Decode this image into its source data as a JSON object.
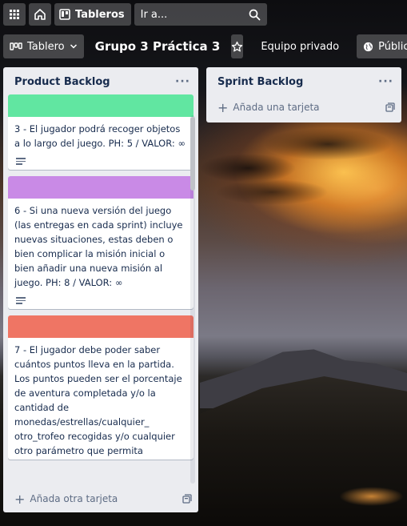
{
  "colors": {
    "label_green": "#61e6a1",
    "label_purple": "#c98ae6",
    "label_red": "#ef7564",
    "list_bg": "#ebecf0"
  },
  "topbar": {
    "apps_icon": "grid-icon",
    "home_icon": "home-icon",
    "boards_label": "Tableros",
    "search_placeholder": "Ir a...",
    "search_icon": "search-icon"
  },
  "boardbar": {
    "view_label": "Tablero",
    "title": "Grupo 3 Práctica 3",
    "team_label": "Equipo privado",
    "visibility_label": "Público"
  },
  "lists": [
    {
      "title": "Product Backlog",
      "add_label": "Añada otra tarjeta",
      "cards": [
        {
          "label": "green",
          "text": "3 - El jugador podrá recoger objetos a lo largo del juego. PH: 5 / VALOR: ∞"
        },
        {
          "label": "purple",
          "text": "6 - Si una nueva versión del juego (las entregas en cada sprint) incluye nuevas situaciones, estas deben o bien complicar la misión inicial o bien añadir una nueva misión al juego. PH: 8 / VALOR: ∞"
        },
        {
          "label": "red",
          "text": "7 - El jugador debe poder saber cuántos puntos lleva en la partida. Los puntos pueden ser el porcentaje de aventura completada y/o la cantidad de monedas/estrellas/cualquier_ otro_trofeo recogidas y/o cualquier otro parámetro que permita"
        }
      ]
    },
    {
      "title": "Sprint Backlog",
      "add_label": "Añada una tarjeta"
    }
  ]
}
